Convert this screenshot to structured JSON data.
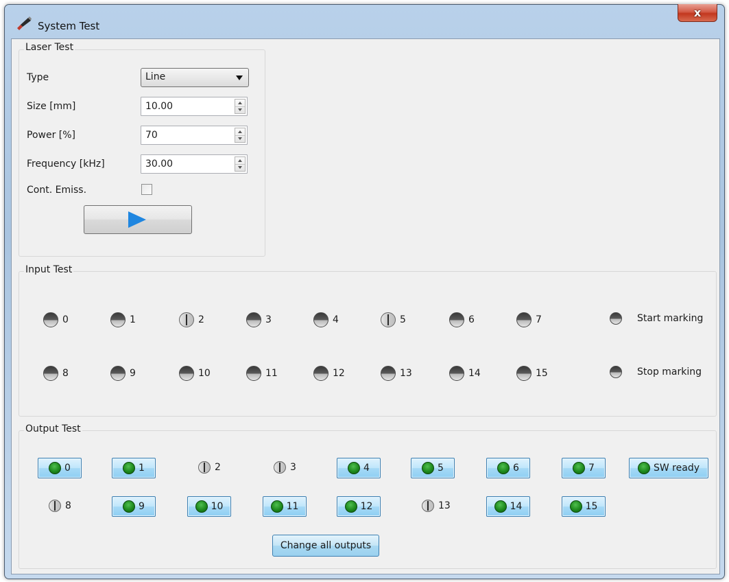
{
  "window": {
    "title": "System Test",
    "close_label": "x"
  },
  "laser_test": {
    "group_label": "Laser Test",
    "type_label": "Type",
    "type_value": "Line",
    "size_label": "Size [mm]",
    "size_value": "10.00",
    "power_label": "Power [%]",
    "power_value": "70",
    "frequency_label": "Frequency [kHz]",
    "frequency_value": "30.00",
    "cont_emiss_label": "Cont. Emiss.",
    "cont_emiss_checked": false
  },
  "input_test": {
    "group_label": "Input Test",
    "row1": [
      {
        "label": "0",
        "state": "half"
      },
      {
        "label": "1",
        "state": "half"
      },
      {
        "label": "2",
        "state": "bar"
      },
      {
        "label": "3",
        "state": "half"
      },
      {
        "label": "4",
        "state": "half"
      },
      {
        "label": "5",
        "state": "bar"
      },
      {
        "label": "6",
        "state": "half"
      },
      {
        "label": "7",
        "state": "half"
      }
    ],
    "row2": [
      {
        "label": "8",
        "state": "half"
      },
      {
        "label": "9",
        "state": "half"
      },
      {
        "label": "10",
        "state": "half"
      },
      {
        "label": "11",
        "state": "half"
      },
      {
        "label": "12",
        "state": "half"
      },
      {
        "label": "13",
        "state": "half"
      },
      {
        "label": "14",
        "state": "half"
      },
      {
        "label": "15",
        "state": "half"
      }
    ],
    "start_marking_label": "Start marking",
    "stop_marking_label": "Stop marking"
  },
  "output_test": {
    "group_label": "Output Test",
    "row1": [
      {
        "label": "0",
        "active": true
      },
      {
        "label": "1",
        "active": true
      },
      {
        "label": "2",
        "active": false
      },
      {
        "label": "3",
        "active": false
      },
      {
        "label": "4",
        "active": true
      },
      {
        "label": "5",
        "active": true
      },
      {
        "label": "6",
        "active": true
      },
      {
        "label": "7",
        "active": true
      }
    ],
    "sw_ready_label": "SW ready",
    "row2": [
      {
        "label": "8",
        "active": false
      },
      {
        "label": "9",
        "active": true
      },
      {
        "label": "10",
        "active": true
      },
      {
        "label": "11",
        "active": true
      },
      {
        "label": "12",
        "active": true
      },
      {
        "label": "13",
        "active": false
      },
      {
        "label": "14",
        "active": true
      },
      {
        "label": "15",
        "active": true
      }
    ],
    "change_all_label": "Change all outputs"
  },
  "icons": {
    "app": "laser-pen-icon",
    "play": "play-icon",
    "led_on_color": "#1e8a1e",
    "accent_blue": "#1f86e0"
  }
}
